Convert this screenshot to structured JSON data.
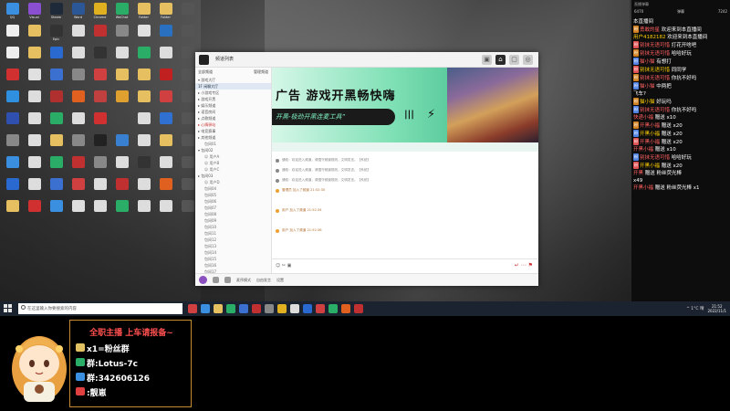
{
  "desktop": {
    "icons": [
      {
        "label": "QQ",
        "color": "#3b8fe0"
      },
      {
        "label": "Visual",
        "color": "#8a4fd0"
      },
      {
        "label": "Steam",
        "color": "#1e2a3a"
      },
      {
        "label": "Word",
        "color": "#2b5797"
      },
      {
        "label": "Chrome",
        "color": "#e0b020"
      },
      {
        "label": "WeChat",
        "color": "#2aae67"
      },
      {
        "label": "Folder",
        "color": "#e6c060"
      },
      {
        "label": "Folder",
        "color": "#e6c060"
      },
      {
        "label": "",
        "color": "#555"
      },
      {
        "label": "",
        "color": "#eee"
      },
      {
        "label": "",
        "color": "#e6c060"
      },
      {
        "label": "Epic",
        "color": "#333"
      },
      {
        "label": "",
        "color": "#ddd"
      },
      {
        "label": "",
        "color": "#c03030"
      },
      {
        "label": "",
        "color": "#888"
      },
      {
        "label": "",
        "color": "#e0e0e0"
      },
      {
        "label": "",
        "color": "#2a70c0"
      },
      {
        "label": "",
        "color": "#555"
      },
      {
        "label": "",
        "color": "#eee"
      },
      {
        "label": "",
        "color": "#e6c060"
      },
      {
        "label": "",
        "color": "#2a6ad0"
      },
      {
        "label": "",
        "color": "#ddd"
      },
      {
        "label": "",
        "color": "#333"
      },
      {
        "label": "",
        "color": "#ddd"
      },
      {
        "label": "",
        "color": "#2aae67"
      },
      {
        "label": "",
        "color": "#ddd"
      },
      {
        "label": "",
        "color": "#555"
      },
      {
        "label": "",
        "color": "#d03030"
      },
      {
        "label": "",
        "color": "#e0e0e0"
      },
      {
        "label": "",
        "color": "#3b70d0"
      },
      {
        "label": "",
        "color": "#888"
      },
      {
        "label": "",
        "color": "#d04040"
      },
      {
        "label": "",
        "color": "#e6c060"
      },
      {
        "label": "",
        "color": "#e6c060"
      },
      {
        "label": "",
        "color": "#c02020"
      },
      {
        "label": "",
        "color": "#555"
      },
      {
        "label": "",
        "color": "#3090e0"
      },
      {
        "label": "",
        "color": "#ddd"
      },
      {
        "label": "",
        "color": "#b03030"
      },
      {
        "label": "",
        "color": "#e06020"
      },
      {
        "label": "",
        "color": "#c04040"
      },
      {
        "label": "",
        "color": "#e0a030"
      },
      {
        "label": "",
        "color": "#e6c060"
      },
      {
        "label": "",
        "color": "#d04040"
      },
      {
        "label": "",
        "color": "#555"
      },
      {
        "label": "",
        "color": "#3050b0"
      },
      {
        "label": "",
        "color": "#ddd"
      },
      {
        "label": "",
        "color": "#2aae67"
      },
      {
        "label": "",
        "color": "#ddd"
      },
      {
        "label": "",
        "color": "#d03030"
      },
      {
        "label": "",
        "color": "#444"
      },
      {
        "label": "",
        "color": "#ddd"
      },
      {
        "label": "",
        "color": "#3070d0"
      },
      {
        "label": "",
        "color": "#555"
      },
      {
        "label": "",
        "color": "#888"
      },
      {
        "label": "",
        "color": "#ddd"
      },
      {
        "label": "",
        "color": "#e6c060"
      },
      {
        "label": "",
        "color": "#888"
      },
      {
        "label": "",
        "color": "#222"
      },
      {
        "label": "",
        "color": "#3a80d0"
      },
      {
        "label": "",
        "color": "#ddd"
      },
      {
        "label": "",
        "color": "#e6c060"
      },
      {
        "label": "",
        "color": "#555"
      },
      {
        "label": "",
        "color": "#3b8fe0"
      },
      {
        "label": "",
        "color": "#ddd"
      },
      {
        "label": "",
        "color": "#2aae67"
      },
      {
        "label": "",
        "color": "#c03030"
      },
      {
        "label": "",
        "color": "#888"
      },
      {
        "label": "",
        "color": "#ddd"
      },
      {
        "label": "",
        "color": "#333"
      },
      {
        "label": "",
        "color": "#ddd"
      },
      {
        "label": "",
        "color": "#555"
      },
      {
        "label": "",
        "color": "#2a6ad0"
      },
      {
        "label": "",
        "color": "#ddd"
      },
      {
        "label": "",
        "color": "#3b70d0"
      },
      {
        "label": "",
        "color": "#d04040"
      },
      {
        "label": "",
        "color": "#ddd"
      },
      {
        "label": "",
        "color": "#c03030"
      },
      {
        "label": "",
        "color": "#ddd"
      },
      {
        "label": "",
        "color": "#e06020"
      },
      {
        "label": "",
        "color": "#555"
      },
      {
        "label": "",
        "color": "#e6c060"
      },
      {
        "label": "",
        "color": "#d03030"
      },
      {
        "label": "",
        "color": "#3b8fe0"
      },
      {
        "label": "",
        "color": "#ddd"
      },
      {
        "label": "",
        "color": "#ddd"
      },
      {
        "label": "",
        "color": "#2aae67"
      },
      {
        "label": "",
        "color": "#ddd"
      },
      {
        "label": "",
        "color": "#ddd"
      },
      {
        "label": "",
        "color": "#555"
      }
    ]
  },
  "app": {
    "title": "频道列表",
    "tools": [
      "▣",
      "⌂",
      "▢",
      "◎"
    ],
    "channel_header": [
      "全部频道",
      "管理频道"
    ],
    "channels": [
      {
        "label": "▾ 游戏大厅",
        "cls": ""
      },
      {
        "label": "1F 闲聊大厅",
        "cls": "sel"
      },
      {
        "label": "▸ 小游戏专区",
        "cls": ""
      },
      {
        "label": "▸ 游戏开黑",
        "cls": ""
      },
      {
        "label": "▸ 娱乐频道",
        "cls": ""
      },
      {
        "label": "▸ 语音房间",
        "cls": ""
      },
      {
        "label": "▸ 点歌频道",
        "cls": ""
      },
      {
        "label": "▸ 心情驿站",
        "cls": "pink"
      },
      {
        "label": "▸ 电竞赛事",
        "cls": ""
      },
      {
        "label": "▸ 其他频道",
        "cls": ""
      },
      {
        "label": "包间01",
        "cls": "sub"
      },
      {
        "label": "▾ 包间02",
        "cls": ""
      },
      {
        "label": "☺ 用户A",
        "cls": "sub"
      },
      {
        "label": "☺ 用户B",
        "cls": "sub"
      },
      {
        "label": "☺ 用户C",
        "cls": "sub"
      },
      {
        "label": "▸ 包间03",
        "cls": ""
      },
      {
        "label": "☺ 用户D",
        "cls": "sub"
      },
      {
        "label": "包间04",
        "cls": "sub"
      },
      {
        "label": "包间05",
        "cls": "sub"
      },
      {
        "label": "包间06",
        "cls": "sub"
      },
      {
        "label": "包间07",
        "cls": "sub"
      },
      {
        "label": "包间08",
        "cls": "sub"
      },
      {
        "label": "包间09",
        "cls": "sub"
      },
      {
        "label": "包间10",
        "cls": "sub"
      },
      {
        "label": "包间11",
        "cls": "sub"
      },
      {
        "label": "包间12",
        "cls": "sub"
      },
      {
        "label": "包间13",
        "cls": "sub"
      },
      {
        "label": "包间14",
        "cls": "sub"
      },
      {
        "label": "包间15",
        "cls": "sub"
      },
      {
        "label": "包间16",
        "cls": "sub"
      },
      {
        "label": "包间17",
        "cls": "sub"
      }
    ],
    "banner": {
      "headline": "广告  游戏开黑畅快嗨",
      "slogan": "开黑-极劲开黑连麦工具”",
      "bars": "|||",
      "bolt": "⚡"
    },
    "messages": [
      {
        "text": "通知：欢迎进入频道，请遵守频道规则，文明发言。【系统】",
        "cls": ""
      },
      {
        "text": "通知：欢迎进入频道，请遵守频道规则，文明发言。【系统】",
        "cls": ""
      },
      {
        "text": "通知：欢迎进入频道，请遵守频道规则，文明发言。【系统】",
        "cls": ""
      },
      {
        "text": "管理员 加入了频道 21:52:30",
        "cls": "user"
      },
      {
        "text": "",
        "cls": ""
      },
      {
        "text": "用户 加入了频道 21:52:34",
        "cls": "user"
      },
      {
        "text": "",
        "cls": ""
      },
      {
        "text": "用户 加入了频道 21:52:36",
        "cls": "user"
      }
    ],
    "composer_left": "☺ ✂ ▣",
    "composer_right": "↵ ⋯ ⚑",
    "bottom_items": [
      "麦序模式",
      "自由发言",
      "设置"
    ]
  },
  "taskbar": {
    "search_placeholder": "在这里输入你要搜索的内容",
    "app_colors": [
      "#d04040",
      "#3b8fe0",
      "#e6c060",
      "#2aae67",
      "#3b70d0",
      "#c03030",
      "#888",
      "#e0b020",
      "#ddd",
      "#2a6ad0",
      "#d04040",
      "#2aae67",
      "#e06020",
      "#c03030"
    ],
    "tray": "^ 1°C 晴",
    "time": "21:52",
    "date": "2022/11/1"
  },
  "danmaku": {
    "top": "直播弹幕",
    "stats": [
      "6470",
      "弹幕",
      "7242"
    ],
    "lines": [
      {
        "badge": "",
        "name": "",
        "text": "本直播间"
      },
      {
        "badge": "粉",
        "name": "勇敢的星",
        "text": "欢迎来到本直播间"
      },
      {
        "badge": "",
        "name": "用户4182182",
        "text": "欢迎来到本直播间"
      },
      {
        "badge": "粉",
        "name": "别抹无语可惜",
        "text": "打花开啥吧"
      },
      {
        "badge": "粉",
        "name": "别抹无语可惜",
        "text": "哈哈好玩"
      },
      {
        "badge": "粉",
        "name": "猫小猫",
        "text": "有想打"
      },
      {
        "badge": "粉",
        "name": "别抹无语可惜",
        "text": "同同学"
      },
      {
        "badge": "粉",
        "name": "别抹无语可惜",
        "text": "你抗不好吗"
      },
      {
        "badge": "粉",
        "name": "猫小猫",
        "text": "中两把"
      },
      {
        "badge": "",
        "name": "",
        "text": "飞车?"
      },
      {
        "badge": "粉",
        "name": "猫小猫",
        "text": "好玩吗"
      },
      {
        "badge": "粉",
        "name": "别抹无语可惜",
        "text": "你抗不好吗"
      },
      {
        "badge": "",
        "name": "快递小福",
        "text": "赠送 x10"
      },
      {
        "badge": "粉",
        "name": "开黑小福",
        "text": "赠送 x20"
      },
      {
        "badge": "粉",
        "name": "开黑小福",
        "text": "赠送 x20"
      },
      {
        "badge": "粉",
        "name": "开黑小福",
        "text": "赠送 x20"
      },
      {
        "badge": "",
        "name": "开黑小福",
        "text": "赠送 x10"
      },
      {
        "badge": "粉",
        "name": "别抹无语可惜",
        "text": "哈哈好玩"
      },
      {
        "badge": "粉",
        "name": "开黑小福",
        "text": "赠送 x20"
      },
      {
        "badge": "",
        "name": "开黑",
        "text": "赠送 粉丝荧光棒"
      },
      {
        "badge": "",
        "name": "",
        "text": "x49"
      },
      {
        "badge": "",
        "name": "开黑小福",
        "text": "赠送 粉丝荧光棒 x1"
      }
    ]
  },
  "overlay": {
    "title": "全职主播  上车请报备~",
    "rows": [
      {
        "text": "x1=粉丝群",
        "icon_color": "#e0c060"
      },
      {
        "text": "群:Lotus-7c",
        "icon_color": "#2aae67"
      },
      {
        "text": "群:342606126",
        "icon_color": "#3b8fe0"
      },
      {
        "text": ":靓崽",
        "icon_color": "#e04040"
      }
    ]
  }
}
